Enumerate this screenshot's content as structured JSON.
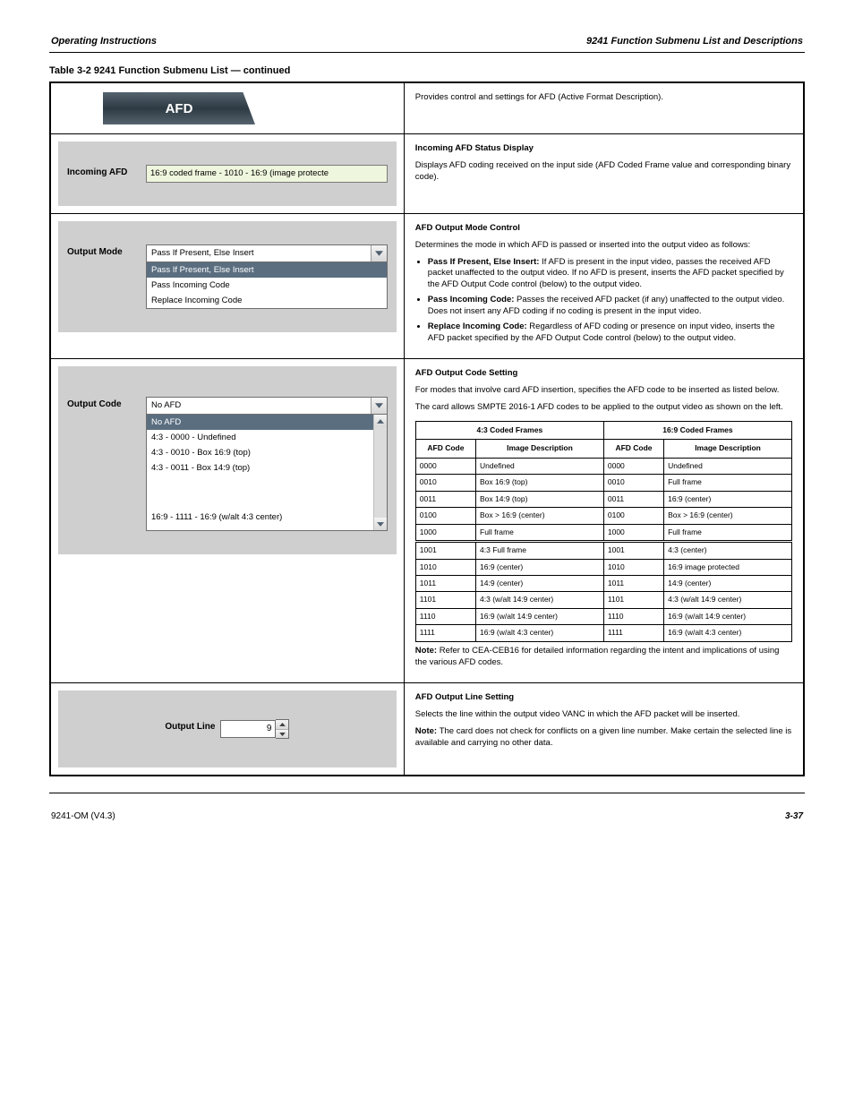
{
  "header": {
    "left": "Operating Instructions",
    "right": "9241 Function Submenu List and Descriptions"
  },
  "table_title": "Table 3-2  9241 Function Submenu List — continued",
  "afd_tab": {
    "label": "AFD"
  },
  "afd_desc": "Provides control and settings for AFD (Active Format Description).",
  "incoming_afd": {
    "caption": "Incoming AFD",
    "value": "16:9 coded frame - 1010 - 16:9 (image protecte",
    "desc_title": "Incoming AFD Status Display",
    "desc_body": "Displays AFD coding received on the input side (AFD Coded Frame value and corresponding binary code)."
  },
  "output_mode": {
    "caption": "Output Mode",
    "value": "Pass If Present, Else Insert",
    "options": [
      "Pass If Present, Else Insert",
      "Pass Incoming Code",
      "Replace Incoming Code"
    ],
    "desc_title": "AFD Output Mode Control",
    "desc_body": "Determines the mode in which AFD is passed or inserted into the output video as follows:",
    "bullets": [
      {
        "bold": "Pass If Present, Else Insert:",
        "text": " If AFD is present in the input video, passes the received AFD packet unaffected to the output video. If no AFD is present, inserts the AFD packet specified by the AFD Output Code control (below) to the output video."
      },
      {
        "bold": "Pass Incoming Code:",
        "text": " Passes the received AFD packet (if any) unaffected to the output video. Does not insert any AFD coding if no coding is present in the input video."
      },
      {
        "bold": "Replace Incoming Code:",
        "text": " Regardless of AFD coding or presence on input video, inserts the AFD packet specified by the AFD Output Code control (below) to the output video."
      }
    ]
  },
  "output_code": {
    "caption": "Output Code",
    "value": "No AFD",
    "options": [
      "No AFD",
      "4:3 - 0000 - Undefined",
      "4:3 - 0010 - Box 16:9 (top)",
      "4:3 - 0011 - Box 14:9 (top)"
    ],
    "last_option": "16:9 - 1111 - 16:9 (w/alt 4:3 center)",
    "desc_title": "AFD Output Code Setting",
    "desc_p1": "For modes that involve card AFD insertion, specifies the AFD code to be inserted as listed below.",
    "desc_p2": "The card allows SMPTE 2016-1 AFD codes to be applied to the output video as shown on the left.",
    "note": "Refer to CEA-CEB16 for detailed information regarding the intent and implications of using the various AFD codes."
  },
  "smpte": {
    "head1": "4:3 Coded Frames",
    "head2": "16:9 Coded Frames",
    "col1": "AFD Code",
    "col2": "Image Description",
    "rows_4_3": [
      [
        "0000",
        "Undefined"
      ],
      [
        "0010",
        "Box 16:9 (top)"
      ],
      [
        "0011",
        "Box 14:9 (top)"
      ],
      [
        "0100",
        "Box > 16:9 (center)"
      ],
      [
        "1000",
        "Full frame"
      ],
      [
        "1001",
        "4:3 Full frame"
      ],
      [
        "1010",
        "16:9 (center)"
      ],
      [
        "1011",
        "14:9 (center)"
      ],
      [
        "1101",
        "4:3 (w/alt 14:9 center)"
      ],
      [
        "1110",
        "16:9 (w/alt 14:9 center)"
      ],
      [
        "1111",
        "16:9 (w/alt 4:3 center)"
      ]
    ],
    "rows_16_9": [
      [
        "0000",
        "Undefined"
      ],
      [
        "0010",
        "Full frame"
      ],
      [
        "0011",
        "16:9 (center)"
      ],
      [
        "0100",
        "Box > 16:9 (center)"
      ],
      [
        "1000",
        "Full frame"
      ],
      [
        "1001",
        "4:3 (center)"
      ],
      [
        "1010",
        "16:9 image protected"
      ],
      [
        "1011",
        "14:9 (center)"
      ],
      [
        "1101",
        "4:3 (w/alt 14:9 center)"
      ],
      [
        "1110",
        "16:9 (w/alt 14:9 center)"
      ],
      [
        "1111",
        "16:9 (w/alt 4:3 center)"
      ]
    ]
  },
  "output_line": {
    "caption": "Output Line",
    "value": "9",
    "desc_title": "AFD Output Line Setting",
    "desc_body": "Selects the line within the output video VANC in which the AFD packet will be inserted.",
    "note": "The card does not check for conflicts on a given line number. Make certain the selected line is available and carrying no other data."
  },
  "footer": {
    "doc": "9241-OM (V4.3)",
    "page": "3-37"
  }
}
